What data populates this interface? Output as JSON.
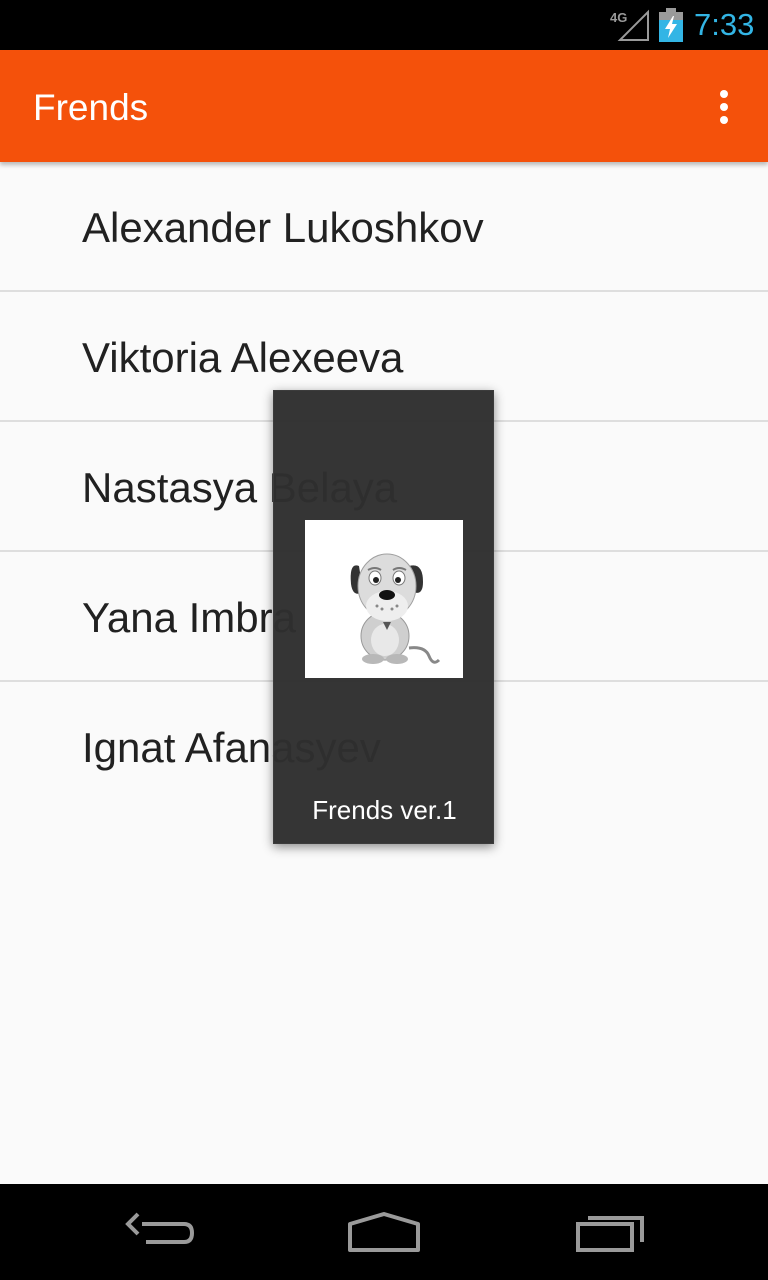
{
  "status_bar": {
    "network": "4G",
    "time": "7:33",
    "signal_icon": "signal-icon",
    "battery_icon": "battery-charging-icon"
  },
  "action_bar": {
    "title": "Frends",
    "overflow_icon": "overflow-menu-icon"
  },
  "list": {
    "items": [
      {
        "name": "Alexander Lukoshkov"
      },
      {
        "name": "Viktoria Alexeeva"
      },
      {
        "name": "Nastasya Belaya"
      },
      {
        "name": "Yana Imbra"
      },
      {
        "name": "Ignat Afanasyev"
      }
    ]
  },
  "toast": {
    "caption": "Frends ver.1",
    "image_icon": "dog-icon"
  },
  "nav_bar": {
    "back_icon": "back-icon",
    "home_icon": "home-icon",
    "recents_icon": "recents-icon"
  },
  "colors": {
    "accent": "#f4510b",
    "status_time": "#33b5e5",
    "list_background": "#fafafa",
    "toast_background": "#2e2e2e"
  }
}
